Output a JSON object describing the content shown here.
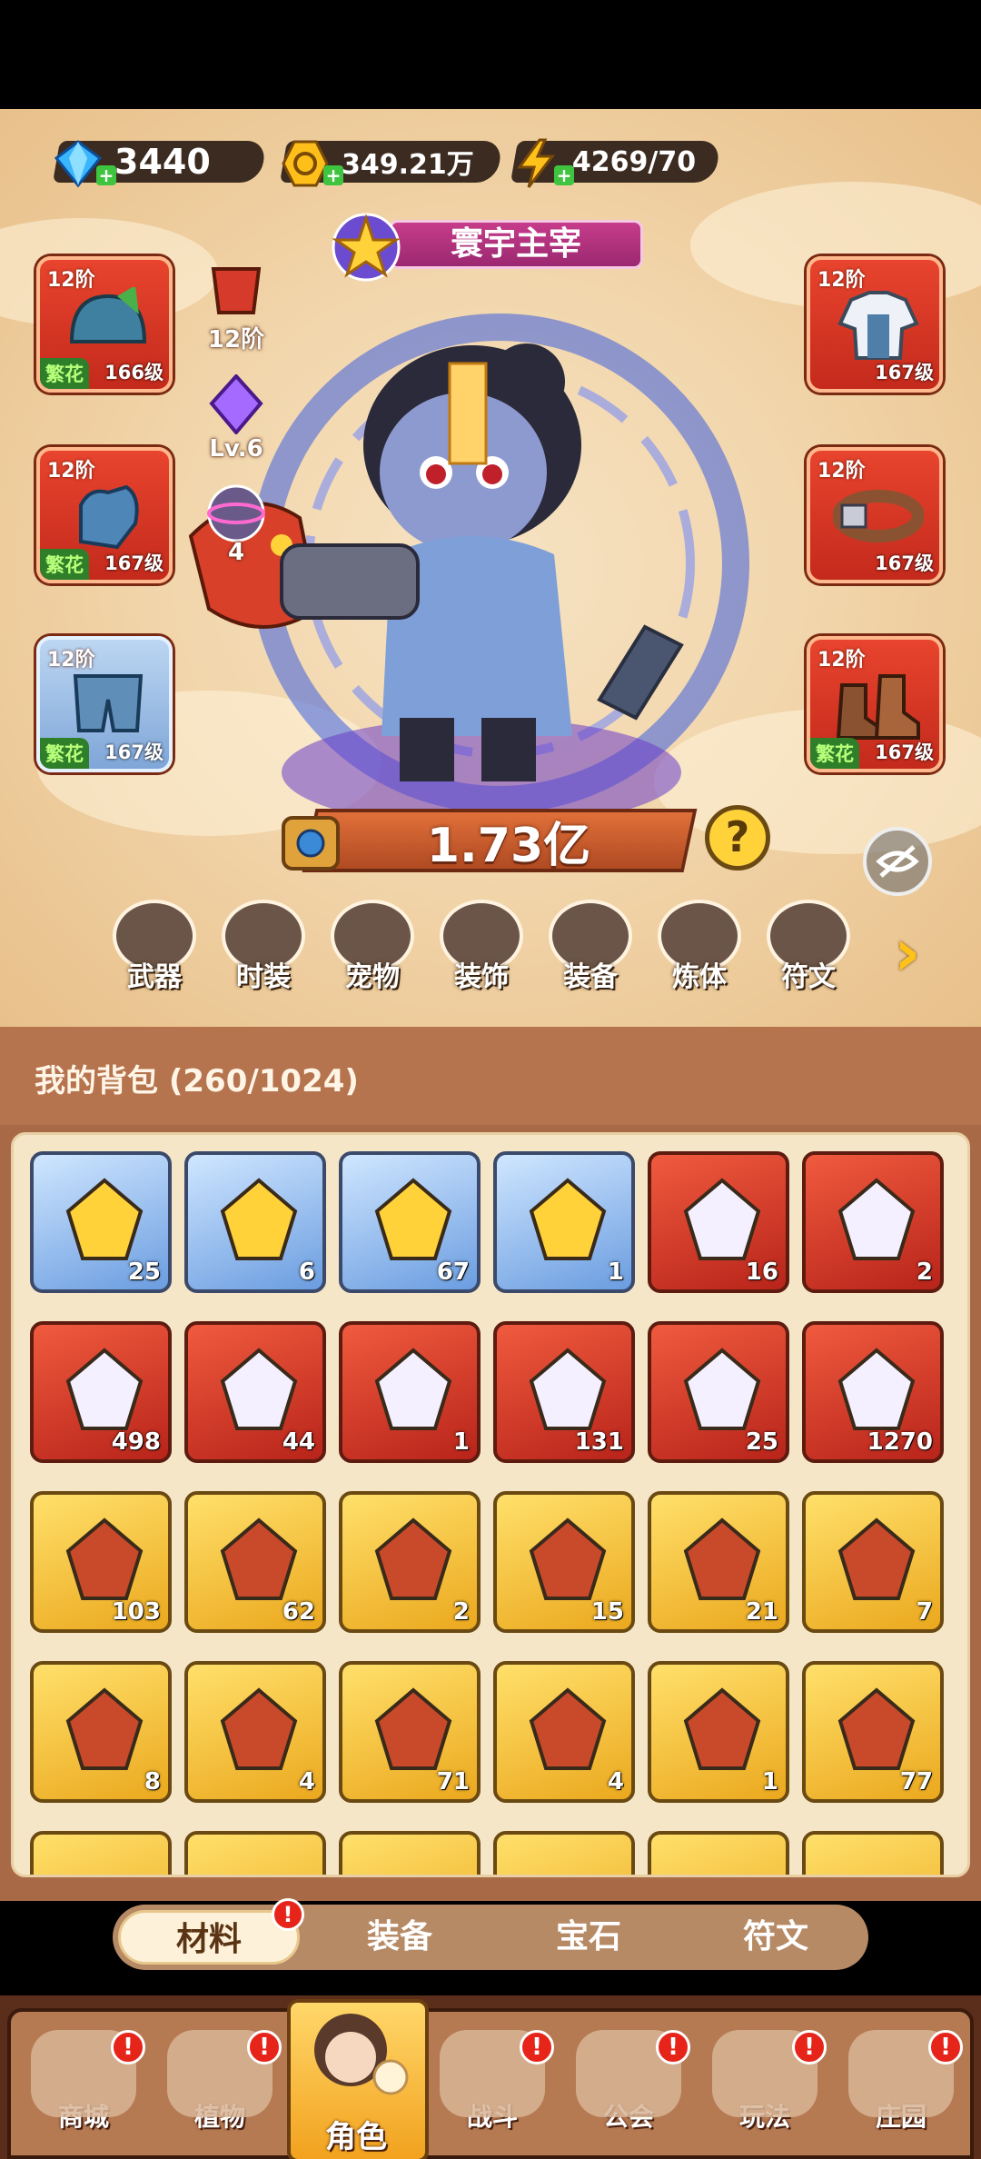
{
  "currencies": {
    "diamonds": "3440",
    "gold": "349.21万",
    "energy": "4269/70"
  },
  "hero": {
    "title": "寰宇主宰",
    "power": "1.73亿",
    "mid_stack": {
      "tier_label": "12阶",
      "level_label": "Lv.6",
      "orbit_count": "4"
    },
    "left_slots": [
      {
        "tier": "12阶",
        "quality": "繁花",
        "level": "166级"
      },
      {
        "tier": "12阶",
        "quality": "繁花",
        "level": "167级"
      },
      {
        "tier": "12阶",
        "quality": "繁花",
        "level": "167级"
      }
    ],
    "right_slots": [
      {
        "tier": "12阶",
        "quality": "",
        "level": "167级"
      },
      {
        "tier": "12阶",
        "quality": "",
        "level": "167级"
      },
      {
        "tier": "12阶",
        "quality": "繁花",
        "level": "167级"
      }
    ],
    "categories": [
      "武器",
      "时装",
      "宠物",
      "装饰",
      "装备",
      "炼体",
      "符文"
    ]
  },
  "bag": {
    "title": "我的背包 (260/1024)",
    "items": [
      {
        "icon": "beetle-gem-icon",
        "count": "25",
        "rarity": "blue"
      },
      {
        "icon": "syringe-icon",
        "count": "6",
        "rarity": "blue"
      },
      {
        "icon": "orbit-orb-icon",
        "count": "67",
        "rarity": "blue"
      },
      {
        "icon": "armored-hero-icon",
        "count": "1",
        "rarity": "blue"
      },
      {
        "icon": "blue-star-crystal-icon",
        "count": "16",
        "rarity": "red"
      },
      {
        "icon": "moon-star-icon",
        "count": "2",
        "rarity": "red"
      },
      {
        "icon": "red-potion-icon",
        "count": "498",
        "rarity": "red"
      },
      {
        "icon": "green-capsule-tube-icon",
        "count": "44",
        "rarity": "red"
      },
      {
        "icon": "green-pill-icon",
        "count": "1",
        "rarity": "red"
      },
      {
        "icon": "hexagram-crystal-icon",
        "count": "131",
        "rarity": "red"
      },
      {
        "icon": "pink-knot-icon",
        "count": "25",
        "rarity": "red"
      },
      {
        "icon": "purple-cubes-icon",
        "count": "1270",
        "rarity": "red"
      },
      {
        "icon": "skull-card-icon",
        "count": "103",
        "rarity": "gold"
      },
      {
        "icon": "golden-flower-icon",
        "count": "62",
        "rarity": "gold"
      },
      {
        "icon": "cake-slice-icon",
        "count": "2",
        "rarity": "gold"
      },
      {
        "icon": "golden-beans-icon",
        "count": "15",
        "rarity": "gold"
      },
      {
        "icon": "ruby-key-icon",
        "count": "21",
        "rarity": "gold"
      },
      {
        "icon": "gold-key-icon",
        "count": "7",
        "rarity": "gold"
      },
      {
        "icon": "emerald-key-icon",
        "count": "8",
        "rarity": "gold"
      },
      {
        "icon": "gold-cube-icon",
        "count": "4",
        "rarity": "gold"
      },
      {
        "icon": "fire-triangle-icon",
        "count": "71",
        "rarity": "gold"
      },
      {
        "icon": "purple-star-orb-icon",
        "count": "4",
        "rarity": "gold"
      },
      {
        "icon": "blue-mushroom-icon",
        "count": "1",
        "rarity": "gold"
      },
      {
        "icon": "red-book-icon",
        "count": "77",
        "rarity": "gold"
      }
    ],
    "tabs": [
      {
        "label": "材料",
        "active": true,
        "badge": "!"
      },
      {
        "label": "装备",
        "active": false
      },
      {
        "label": "宝石",
        "active": false
      },
      {
        "label": "符文",
        "active": false
      }
    ]
  },
  "nav": [
    {
      "label": "商城",
      "badge": "!"
    },
    {
      "label": "植物",
      "badge": "!"
    },
    {
      "label": "角色",
      "active": true
    },
    {
      "label": "战斗",
      "badge": "!"
    },
    {
      "label": "公会",
      "badge": "!"
    },
    {
      "label": "玩法",
      "badge": "!"
    },
    {
      "label": "庄园",
      "badge": "!"
    }
  ],
  "colors": {
    "accent_red": "#e6241a",
    "panel_brown": "#b5734e",
    "quality_green": "#2f7f2a"
  }
}
